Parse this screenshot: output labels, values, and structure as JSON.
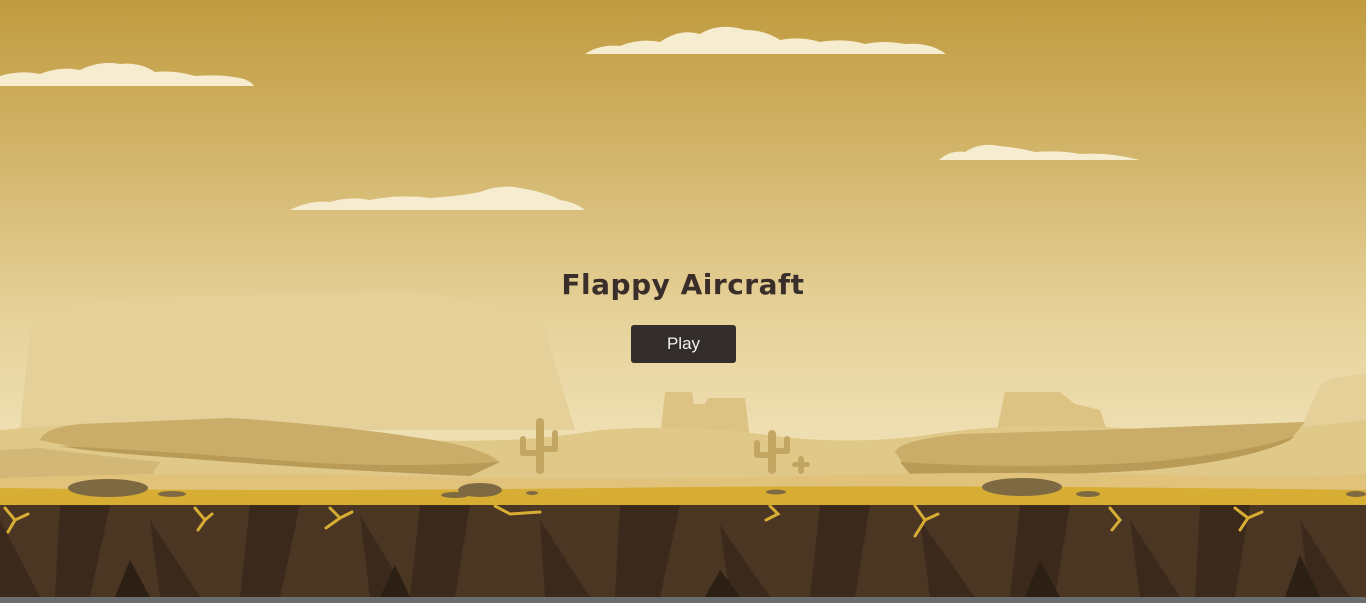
{
  "game": {
    "title": "Flappy Aircraft",
    "play_label": "Play"
  },
  "colors": {
    "sky_top": "#c29c3d",
    "sky_bottom": "#efe1b3",
    "cloud": "#f6ecd0",
    "ground_top": "#d9b03a",
    "earth": "#4b3523",
    "button": "#332d2b",
    "title": "#3a2e2a"
  },
  "icons": [
    "cloud-icon",
    "cactus-icon",
    "rock-icon"
  ]
}
